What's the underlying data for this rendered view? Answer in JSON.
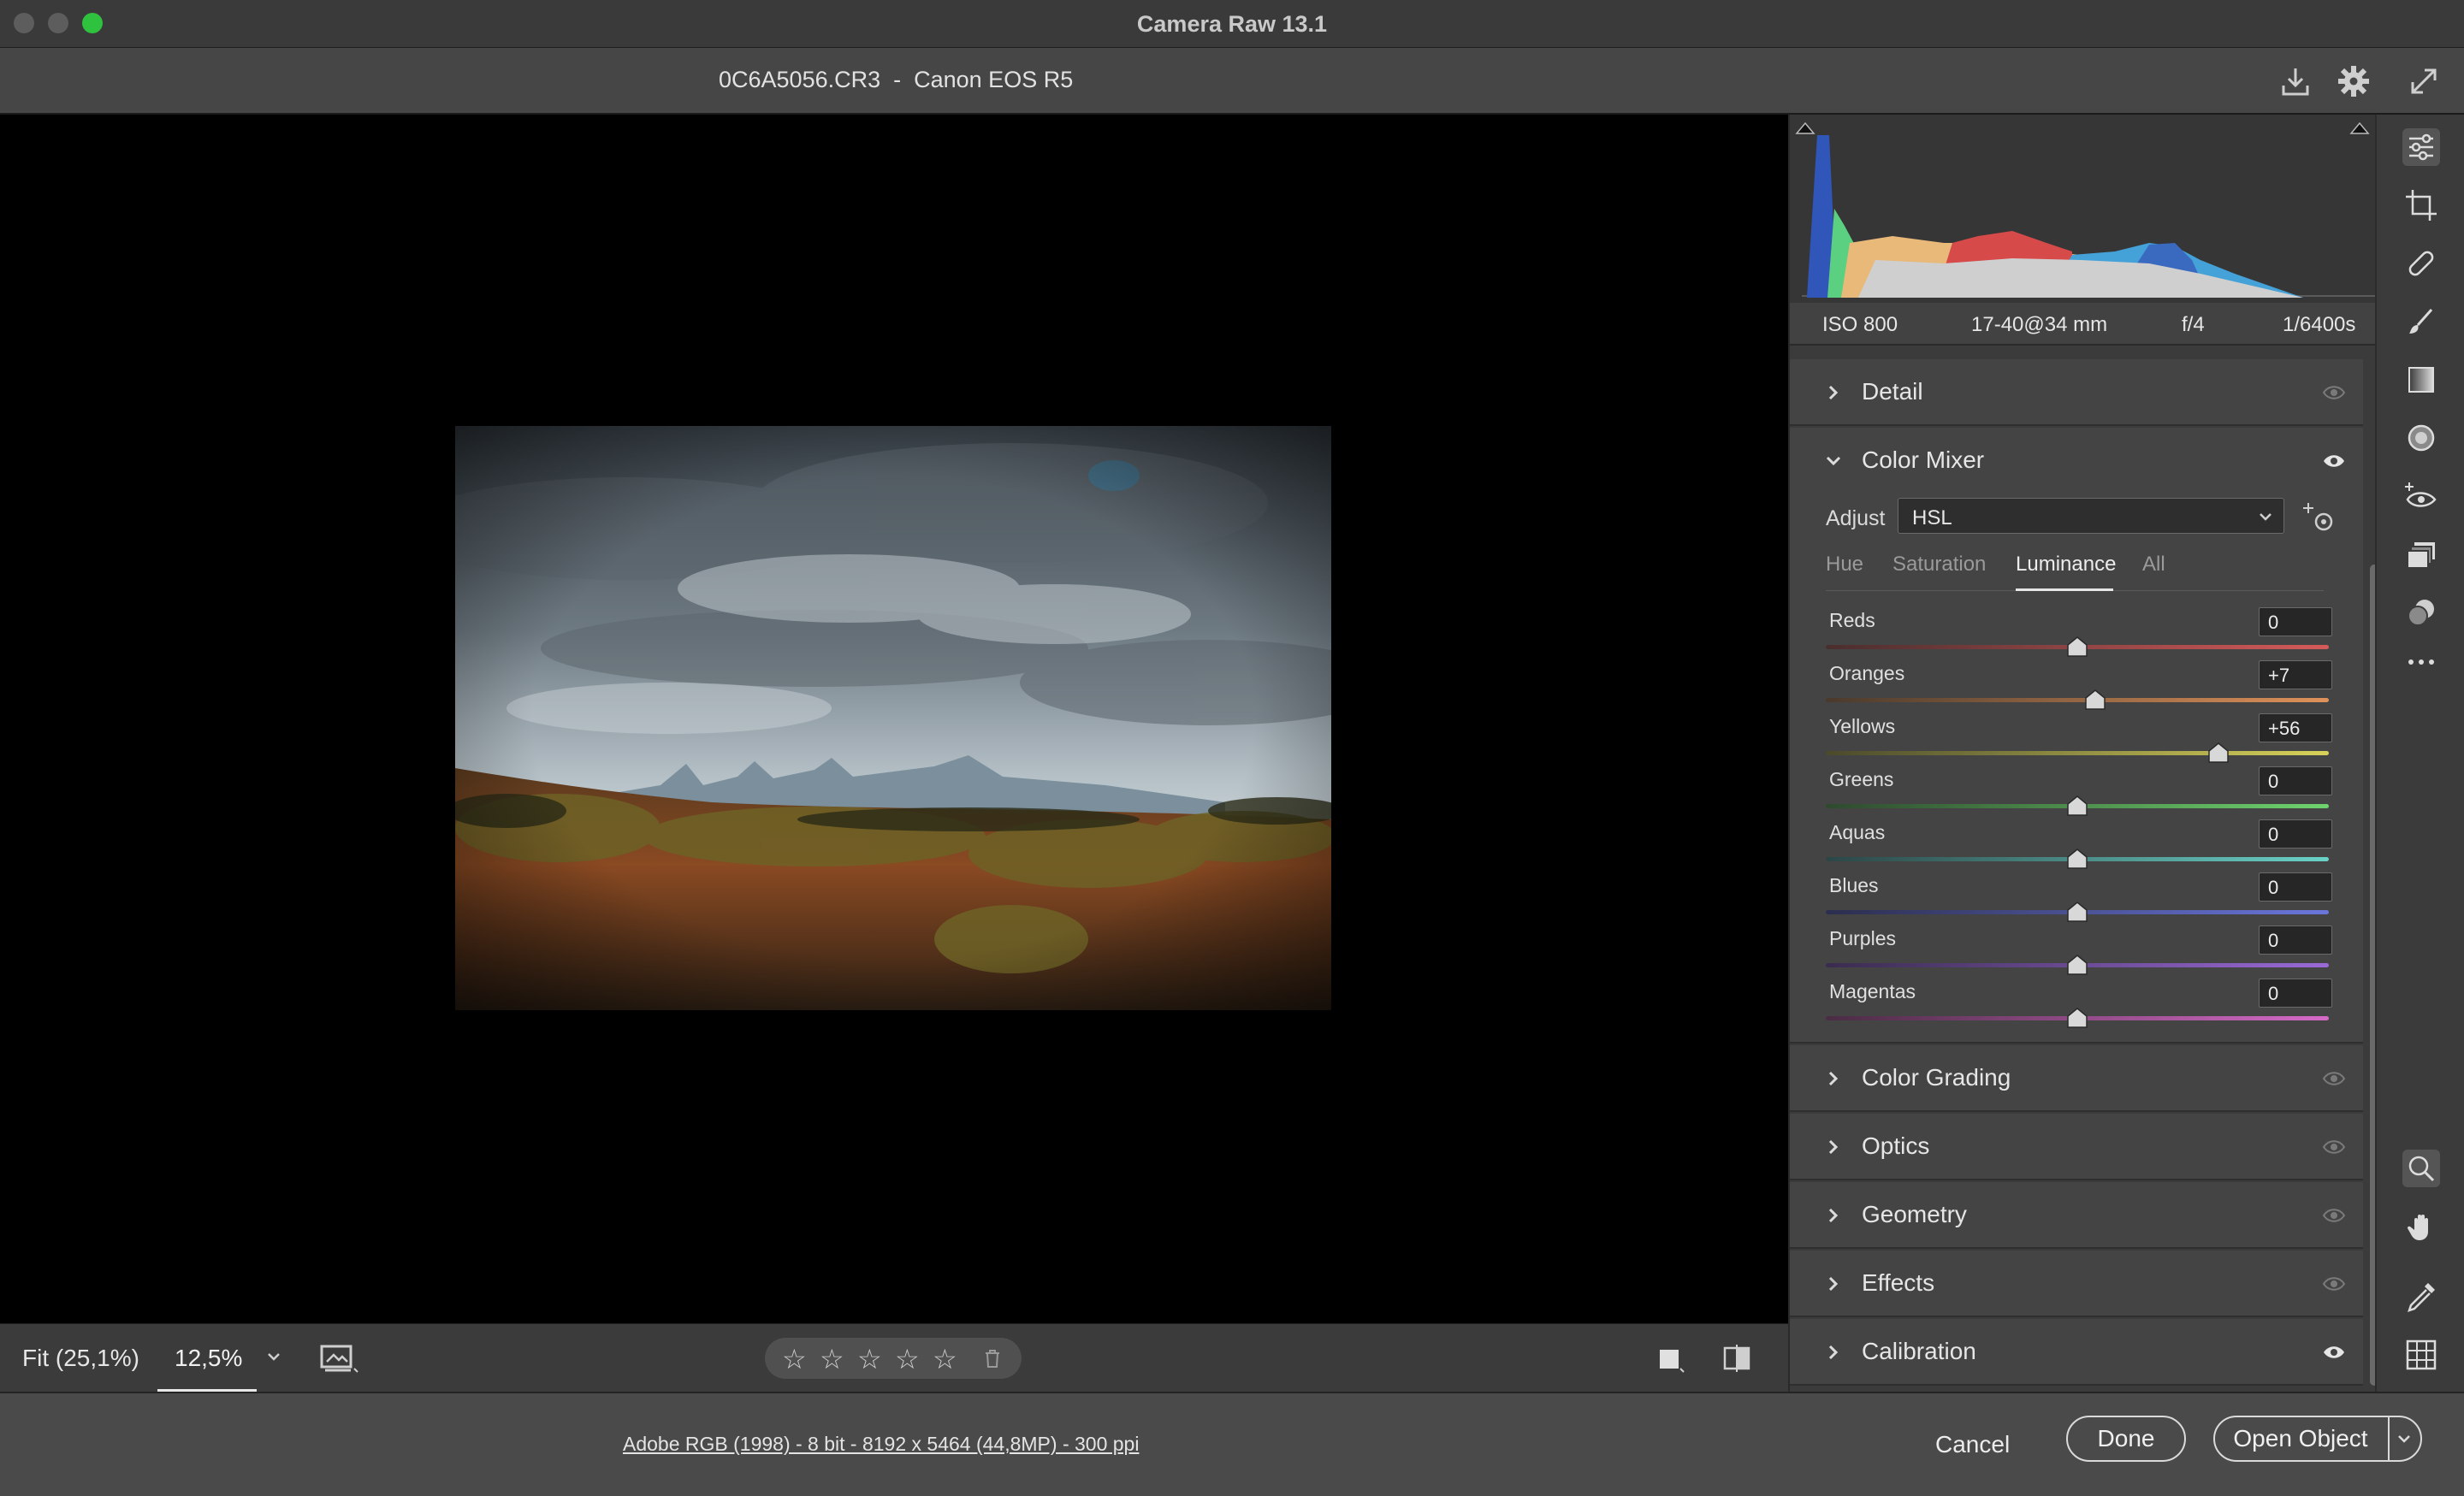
{
  "window": {
    "title": "Camera Raw 13.1"
  },
  "header": {
    "file_title": "0C6A5056.CR3  -  Canon EOS R5"
  },
  "exif": {
    "iso": "ISO 800",
    "lens": "17-40@34 mm",
    "aperture": "f/4",
    "shutter": "1/6400s"
  },
  "panels": {
    "detail": "Detail",
    "color_mixer": {
      "title": "Color Mixer",
      "adjust_label": "Adjust",
      "adjust_value": "HSL",
      "tabs": [
        "Hue",
        "Saturation",
        "Luminance",
        "All"
      ],
      "active_tab": "Luminance",
      "sliders": [
        {
          "label": "Reds",
          "value": "0",
          "num": 0,
          "colors": [
            "#4a2e2e",
            "#d65a5a"
          ]
        },
        {
          "label": "Oranges",
          "value": "+7",
          "num": 7,
          "colors": [
            "#4a3a2c",
            "#e0925a"
          ]
        },
        {
          "label": "Yellows",
          "value": "+56",
          "num": 56,
          "colors": [
            "#4a4a2c",
            "#d8d25a"
          ]
        },
        {
          "label": "Greens",
          "value": "0",
          "num": 0,
          "colors": [
            "#2e4a2e",
            "#6ed46e"
          ]
        },
        {
          "label": "Aquas",
          "value": "0",
          "num": 0,
          "colors": [
            "#2c4646",
            "#6ad2c8"
          ]
        },
        {
          "label": "Blues",
          "value": "0",
          "num": 0,
          "colors": [
            "#2c2e4e",
            "#6a76dc"
          ]
        },
        {
          "label": "Purples",
          "value": "0",
          "num": 0,
          "colors": [
            "#3a2c4e",
            "#9a6ad8"
          ]
        },
        {
          "label": "Magentas",
          "value": "0",
          "num": 0,
          "colors": [
            "#4a2c44",
            "#d66ac8"
          ]
        }
      ]
    },
    "color_grading": "Color Grading",
    "optics": "Optics",
    "geometry": "Geometry",
    "effects": "Effects",
    "calibration": "Calibration"
  },
  "footer": {
    "fit_label": "Fit (25,1%)",
    "zoom_value": "12,5%",
    "workflow": "Adobe RGB (1998) - 8 bit - 8192 x 5464 (44,8MP) - 300 ppi"
  },
  "actions": {
    "cancel": "Cancel",
    "done": "Done",
    "open": "Open Object"
  },
  "colors": {
    "panel": "#444444",
    "accent_green": "#2fc23f",
    "canvas": "#000000"
  }
}
